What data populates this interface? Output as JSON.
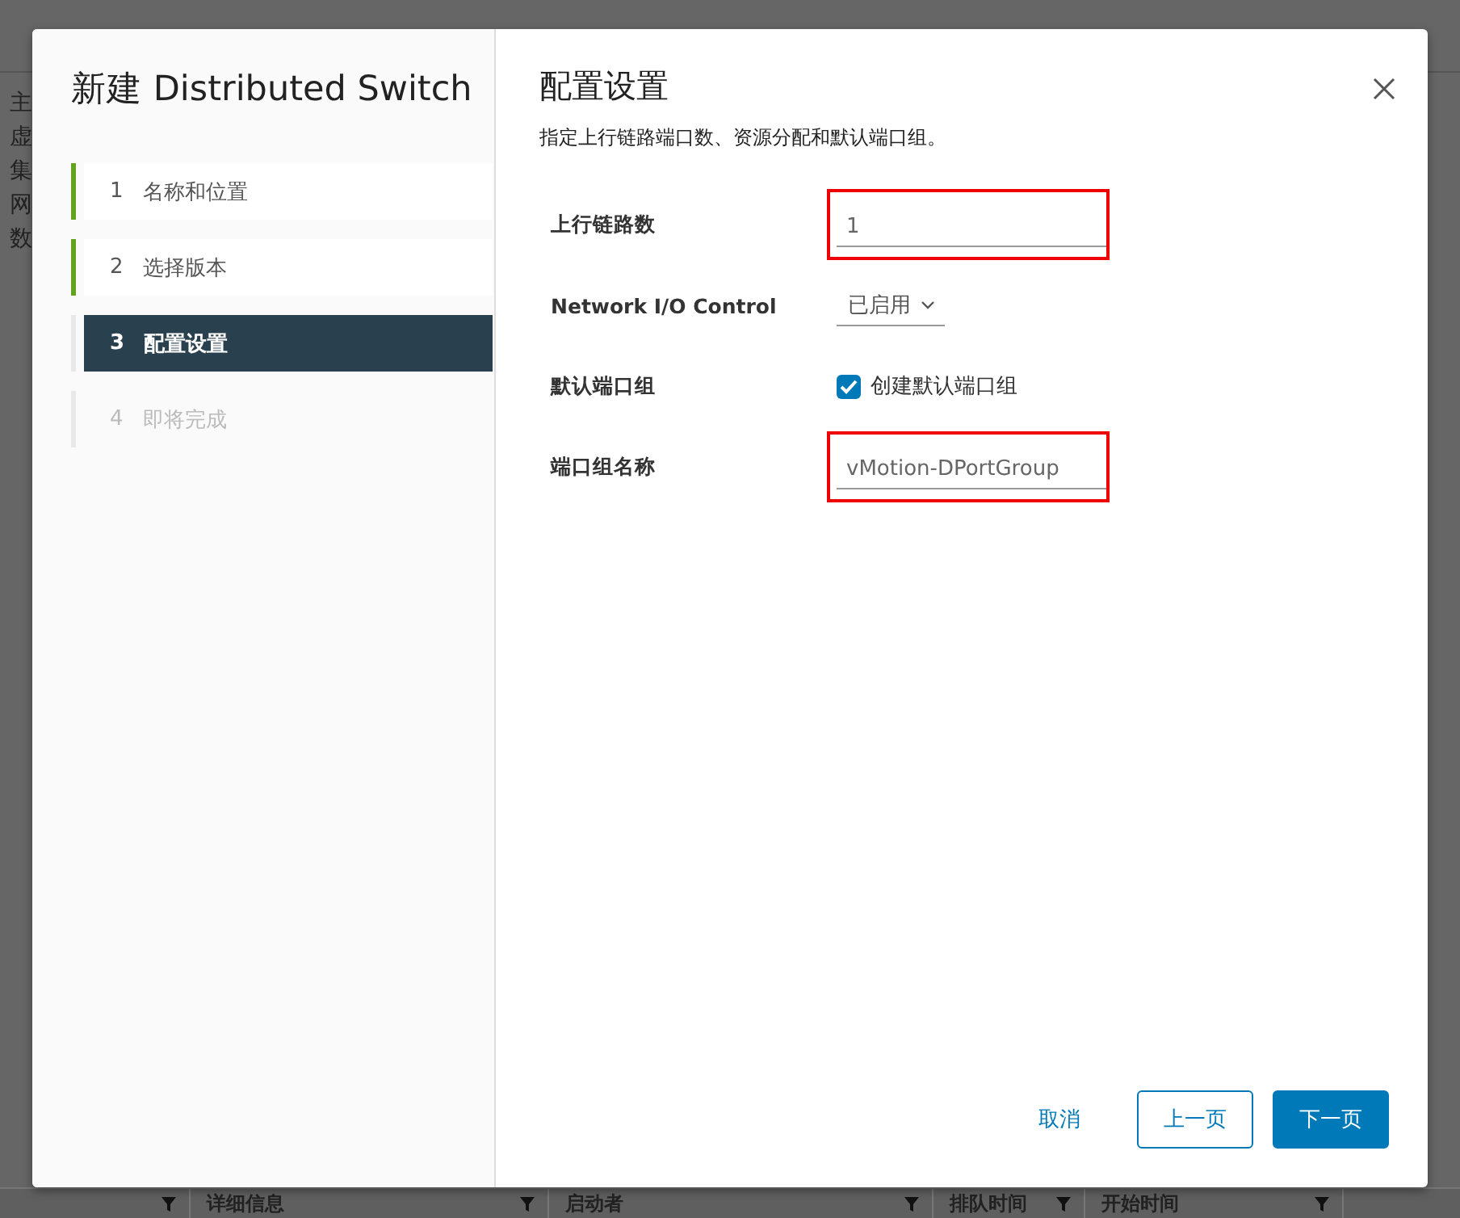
{
  "background": {
    "nav_items": [
      "主",
      "虚",
      "集",
      "网",
      "数"
    ],
    "table_columns": [
      {
        "label": "详细信息"
      },
      {
        "label": "启动者"
      },
      {
        "label": "排队时间"
      },
      {
        "label": "开始时间"
      }
    ]
  },
  "dialog": {
    "title": "新建 Distributed Switch",
    "steps": [
      {
        "number": "1",
        "label": "名称和位置",
        "completed": true,
        "disabled": false,
        "selected": false
      },
      {
        "number": "2",
        "label": "选择版本",
        "completed": true,
        "disabled": false,
        "selected": false
      },
      {
        "number": "3",
        "label": "配置设置",
        "completed": false,
        "disabled": false,
        "selected": true
      },
      {
        "number": "4",
        "label": "即将完成",
        "completed": false,
        "disabled": true,
        "selected": false
      }
    ],
    "heading": "配置设置",
    "description": "指定上行链路端口数、资源分配和默认端口组。",
    "fields": [
      {
        "kind": "text",
        "label": "上行链路数",
        "value": "1",
        "highlighted": true
      },
      {
        "kind": "dropdown",
        "label": "Network I/O Control",
        "value": "已启用",
        "highlighted": false
      },
      {
        "kind": "checkbox",
        "label": "默认端口组",
        "option": "创建默认端口组",
        "checked": true,
        "highlighted": false
      },
      {
        "kind": "text",
        "label": "端口组名称",
        "value": "vMotion-DPortGroup",
        "highlighted": true
      }
    ],
    "buttons": [
      {
        "kind": "link",
        "label": "取消"
      },
      {
        "kind": "outline",
        "label": "上一页"
      },
      {
        "kind": "primary",
        "label": "下一页"
      }
    ]
  }
}
